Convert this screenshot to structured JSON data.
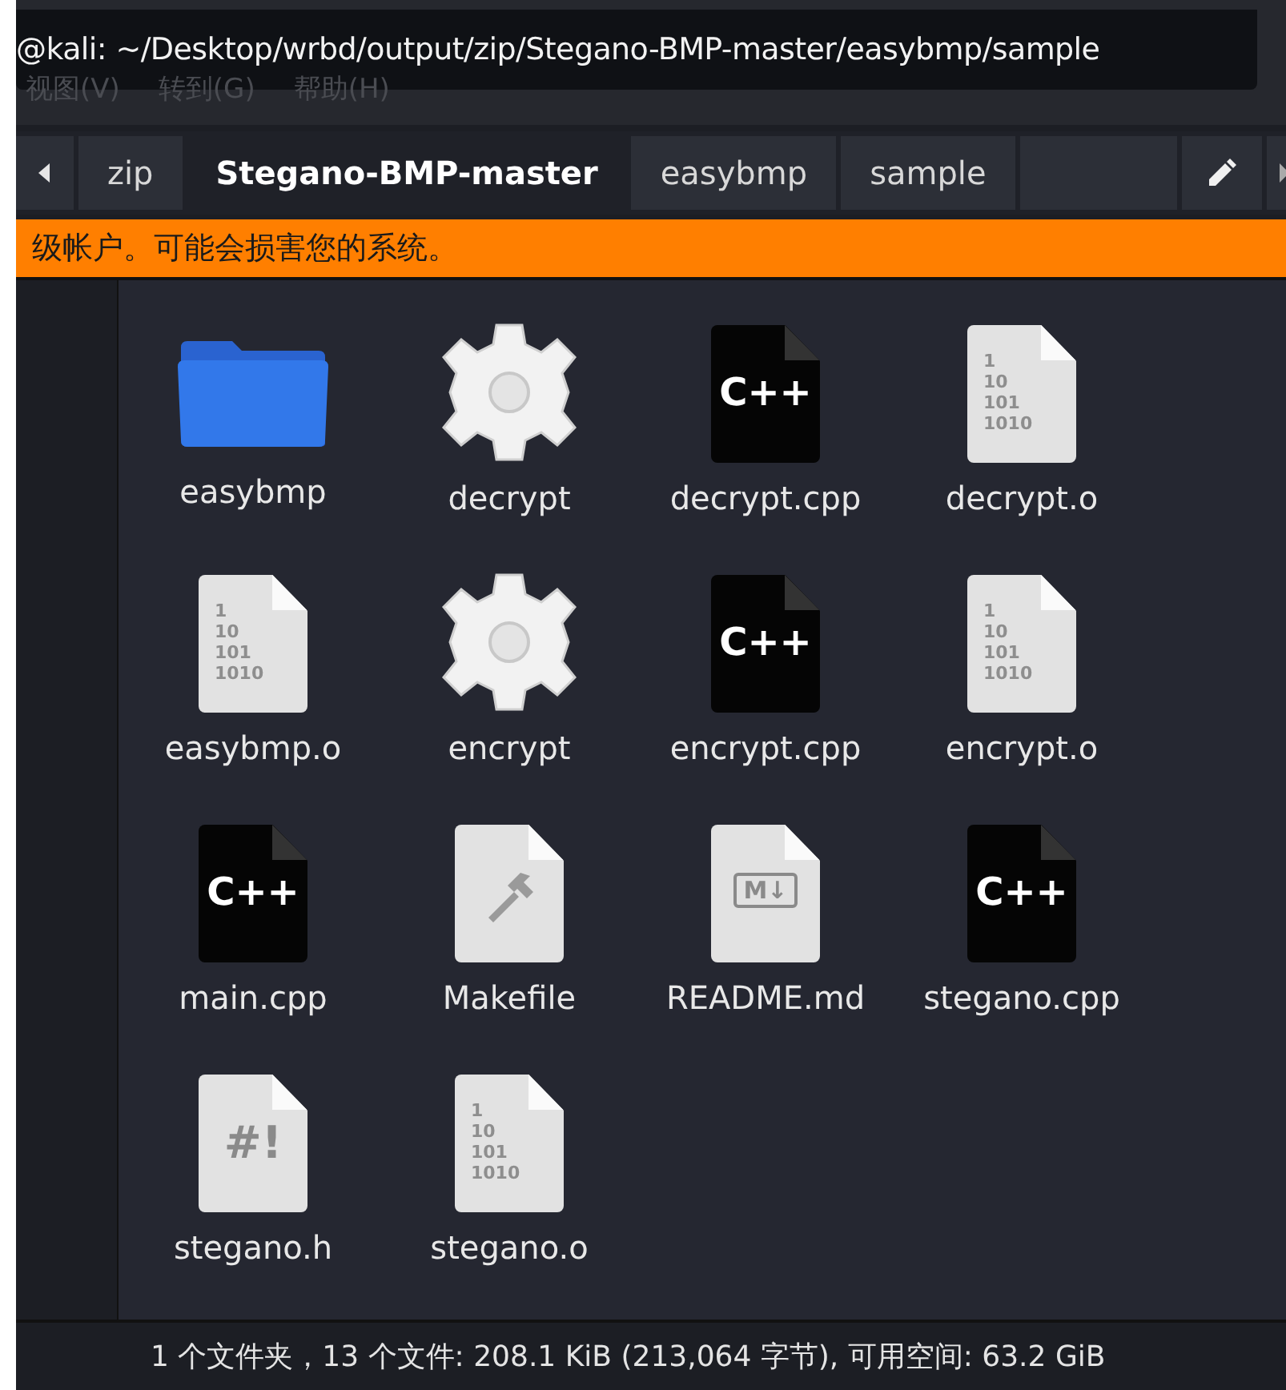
{
  "terminal_title": "@kali: ~/Desktop/wrbd/output/zip/Stegano-BMP-master/easybmp/sample",
  "menu": [
    "视图(V)",
    "转到(G)",
    "帮助(H)"
  ],
  "path_bar": {
    "crumbs": [
      {
        "label": "zip",
        "selected": false
      },
      {
        "label": "Stegano-BMP-master",
        "selected": true
      },
      {
        "label": "easybmp",
        "selected": false
      },
      {
        "label": "sample",
        "selected": false
      }
    ]
  },
  "warning": "级帐户。可能会损害您的系统。",
  "files": [
    {
      "name": "easybmp",
      "kind": "folder"
    },
    {
      "name": "decrypt",
      "kind": "executable"
    },
    {
      "name": "decrypt.cpp",
      "kind": "cpp",
      "glyph": "C++"
    },
    {
      "name": "decrypt.o",
      "kind": "binary",
      "glyph_lines": [
        "1",
        "10",
        "101",
        "1010"
      ]
    },
    {
      "name": "easybmp.o",
      "kind": "binary",
      "glyph_lines": [
        "1",
        "10",
        "101",
        "1010"
      ]
    },
    {
      "name": "encrypt",
      "kind": "executable"
    },
    {
      "name": "encrypt.cpp",
      "kind": "cpp",
      "glyph": "C++"
    },
    {
      "name": "encrypt.o",
      "kind": "binary",
      "glyph_lines": [
        "1",
        "10",
        "101",
        "1010"
      ]
    },
    {
      "name": "main.cpp",
      "kind": "cpp",
      "glyph": "C++"
    },
    {
      "name": "Makefile",
      "kind": "makefile"
    },
    {
      "name": "README.md",
      "kind": "markdown",
      "glyph": "M↓"
    },
    {
      "name": "stegano.cpp",
      "kind": "cpp",
      "glyph": "C++"
    },
    {
      "name": "stegano.h",
      "kind": "header",
      "glyph": "#!"
    },
    {
      "name": "stegano.o",
      "kind": "binary",
      "glyph_lines": [
        "1",
        "10",
        "101",
        "1010"
      ]
    }
  ],
  "status_bar": "1 个文件夹，13 个文件: 208.1 KiB (213,064 字节), 可用空间: 63.2 GiB"
}
